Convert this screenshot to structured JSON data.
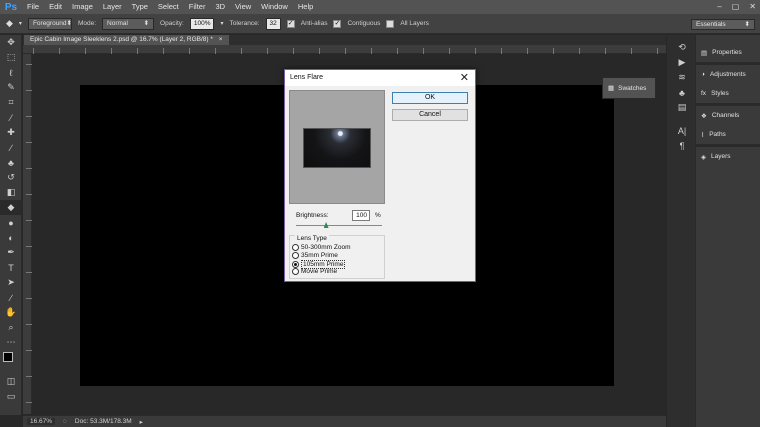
{
  "app": {
    "logo": "Ps"
  },
  "menu": [
    "File",
    "Edit",
    "Image",
    "Layer",
    "Type",
    "Select",
    "Filter",
    "3D",
    "View",
    "Window",
    "Help"
  ],
  "window_controls": {
    "minimize": "–",
    "maximize": "▢",
    "close": "✕"
  },
  "options_bar": {
    "fill_source": "Foreground",
    "mode_label": "Mode:",
    "mode_value": "Normal",
    "opacity_label": "Opacity:",
    "opacity_value": "100%",
    "tolerance_label": "Tolerance:",
    "tolerance_value": "32",
    "anti_alias_label": "Anti-alias",
    "contiguous_label": "Contiguous",
    "all_layers_label": "All Layers"
  },
  "workspace_preset": "Essentials",
  "document": {
    "tab_title": "Epic Cabin Image Sleeklens 2.psd @ 16.7% (Layer 2, RGB/8) *",
    "tab_close": "×"
  },
  "status": {
    "zoom": "16.67%",
    "doc_info": "Doc: 53.3M/178.3M"
  },
  "panels": {
    "swatches": "Swatches",
    "items": [
      "Properties",
      "Adjustments",
      "Styles",
      "Channels",
      "Paths",
      "Layers"
    ]
  },
  "dialog": {
    "title": "Lens Flare",
    "close": "✕",
    "ok_label": "OK",
    "cancel_label": "Cancel",
    "brightness_label": "Brightness:",
    "brightness_value": "100",
    "brightness_unit": "%",
    "brightness_slider_fraction": 0.35,
    "lens_type_label": "Lens Type",
    "lens_options": [
      "50-300mm Zoom",
      "35mm Prime",
      "105mm Prime",
      "Movie Prime"
    ],
    "selected_lens": "105mm Prime"
  },
  "colors": {
    "accent": "#3fa3ff",
    "dialog_border": "#7a5ca6",
    "foreground_swatch": "#000000",
    "background_swatch": "#1a1aa0"
  }
}
